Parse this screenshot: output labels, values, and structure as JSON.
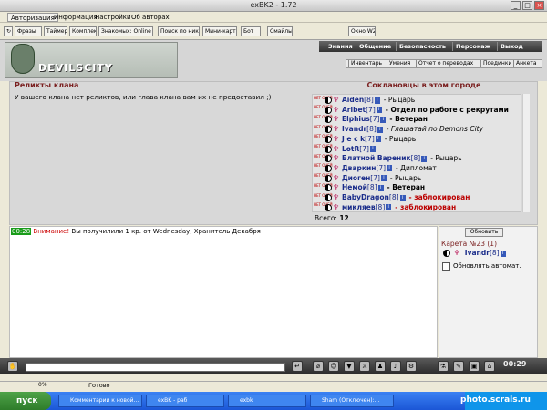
{
  "window": {
    "title": "exBK2 - 1.72"
  },
  "menu": [
    "Авторизация",
    "Информация",
    "Настройки",
    "Об авторах"
  ],
  "toolbar": {
    "phrases": "Фразы",
    "timer": "Таймер",
    "kit": "Комплект",
    "online": "Знакомых: Online -",
    "find_nick": "Поиск по нику",
    "minimap": "Мини-карта",
    "bot": "Бот",
    "smileys": "Смайлы",
    "window_w2": "Окно W2"
  },
  "header": {
    "logo_text": "DEVILSCITY",
    "nav": [
      "Знания",
      "Общение",
      "Безопасность",
      "Персонаж",
      "Выход"
    ],
    "subnav": [
      "Инвентарь",
      "Умения",
      "Отчет о переводах",
      "Поединки",
      "Анкета"
    ]
  },
  "relics": {
    "title": "Реликты клана",
    "text": "У вашего клана нет реликтов, или глава клана вам их не предоставил ;)"
  },
  "allies": {
    "title": "Соклановцы в этом городе",
    "tag": "НЕТ ОЧЕЙ",
    "info": "i",
    "members": [
      {
        "name": "Aiden",
        "level": "[8]",
        "status": "- Рыцарь",
        "style": "normal"
      },
      {
        "name": "Aribet",
        "level": "[7]",
        "status": "- Отдел по работе с рекрутами",
        "style": "bold"
      },
      {
        "name": "Elphius",
        "level": "[7]",
        "status": "- Ветеран",
        "style": "bold"
      },
      {
        "name": "Ivandr",
        "level": "[8]",
        "status": "- Глашатай по Demons City",
        "style": "italic"
      },
      {
        "name": "J e c k",
        "level": "[7]",
        "status": "- Рыцарь",
        "style": "normal"
      },
      {
        "name": "LotR",
        "level": "[7]",
        "status": "",
        "style": "normal"
      },
      {
        "name": "Блатной Вареник",
        "level": "[8]",
        "status": "- Рыцарь",
        "style": "normal"
      },
      {
        "name": "Дваркин",
        "level": "[7]",
        "status": "- Дипломат",
        "style": "normal"
      },
      {
        "name": "Диоген",
        "level": "[7]",
        "status": "- Рыцарь",
        "style": "normal"
      },
      {
        "name": "Немой",
        "level": "[8]",
        "status": "- Ветеран",
        "style": "bold"
      },
      {
        "name": "BabyDragon",
        "level": "[8]",
        "status": "- заблокирован",
        "style": "red"
      },
      {
        "name": "микляев",
        "level": "[8]",
        "status": "- заблокирован",
        "style": "red"
      }
    ],
    "total_label": "Всего:",
    "total_value": "12"
  },
  "chat": {
    "time": "00:28",
    "warning": "Внимание!",
    "message": "Вы получилили 1 кр. от Wednesday, Хранитель Декабря"
  },
  "side": {
    "refresh": "Обновить",
    "map_label": "Карета №23 (1)",
    "user": "Ivandr",
    "user_level": "[8]",
    "auto_label": "Обновлять автомат."
  },
  "clock": "00:29",
  "status": {
    "percent": "0%",
    "ready": "Готово"
  },
  "taskbar": {
    "start": "пуск",
    "tasks": [
      "Комментарии к новой...",
      "exBK - раб",
      "exbk",
      "Sham (Отключен):..."
    ],
    "watermark": "photo.scrals.ru"
  }
}
